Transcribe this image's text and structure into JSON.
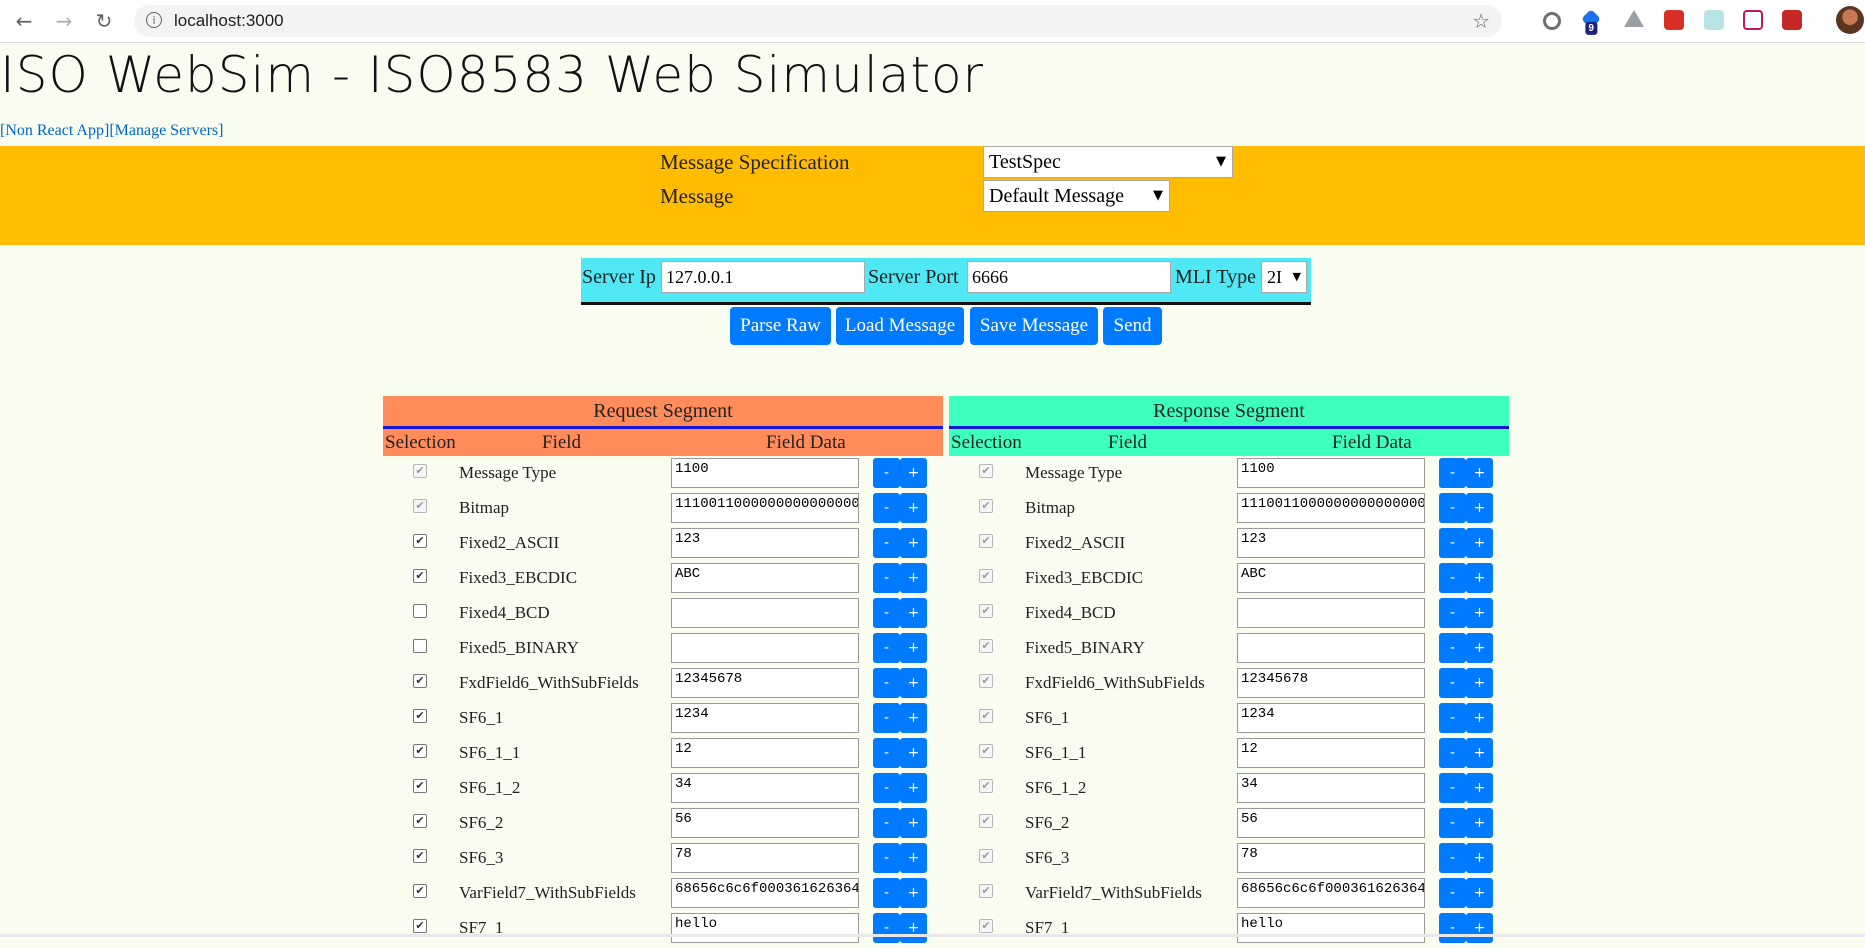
{
  "browser": {
    "url": "localhost:3000",
    "ext_badge": "9"
  },
  "page": {
    "title": "ISO WebSim - ISO8583 Web Simulator",
    "link_non_react": "[Non React App]",
    "link_manage_servers": "[Manage Servers]"
  },
  "spec": {
    "spec_label": "Message Specification",
    "spec_value": "TestSpec",
    "message_label": "Message",
    "message_value": "Default Message"
  },
  "server": {
    "ip_label": "Server Ip",
    "ip_value": "127.0.0.1",
    "port_label": "Server Port",
    "port_value": "6666",
    "mli_label": "MLI Type",
    "mli_value": "2I"
  },
  "actions": {
    "parse_raw": "Parse Raw",
    "load_message": "Load Message",
    "save_message": "Save Message",
    "send": "Send"
  },
  "request": {
    "title": "Request Segment",
    "color": "#ff8c5a",
    "col_selection": "Selection",
    "col_field": "Field",
    "col_data": "Field Data",
    "rows": [
      {
        "checked": true,
        "disabled": true,
        "field": "Message Type",
        "data": "1100"
      },
      {
        "checked": true,
        "disabled": true,
        "field": "Bitmap",
        "data": "1110011000000000000000"
      },
      {
        "checked": true,
        "disabled": false,
        "field": "Fixed2_ASCII",
        "data": "123"
      },
      {
        "checked": true,
        "disabled": false,
        "field": "Fixed3_EBCDIC",
        "data": "ABC"
      },
      {
        "checked": false,
        "disabled": false,
        "field": "Fixed4_BCD",
        "data": ""
      },
      {
        "checked": false,
        "disabled": false,
        "field": "Fixed5_BINARY",
        "data": ""
      },
      {
        "checked": true,
        "disabled": false,
        "field": "FxdField6_WithSubFields",
        "data": "12345678"
      },
      {
        "checked": true,
        "disabled": false,
        "field": "SF6_1",
        "data": "1234"
      },
      {
        "checked": true,
        "disabled": false,
        "field": "SF6_1_1",
        "data": "12"
      },
      {
        "checked": true,
        "disabled": false,
        "field": "SF6_1_2",
        "data": "34"
      },
      {
        "checked": true,
        "disabled": false,
        "field": "SF6_2",
        "data": "56"
      },
      {
        "checked": true,
        "disabled": false,
        "field": "SF6_3",
        "data": "78"
      },
      {
        "checked": true,
        "disabled": false,
        "field": "VarField7_WithSubFields",
        "data": "68656c6c6f000361626364"
      },
      {
        "checked": true,
        "disabled": false,
        "field": "SF7_1",
        "data": "hello"
      }
    ]
  },
  "response": {
    "title": "Response Segment",
    "color": "#3dffbe",
    "col_selection": "Selection",
    "col_field": "Field",
    "col_data": "Field Data",
    "rows": [
      {
        "checked": true,
        "disabled": true,
        "field": "Message Type",
        "data": "1100"
      },
      {
        "checked": true,
        "disabled": true,
        "field": "Bitmap",
        "data": "1110011000000000000000"
      },
      {
        "checked": true,
        "disabled": true,
        "field": "Fixed2_ASCII",
        "data": "123"
      },
      {
        "checked": true,
        "disabled": true,
        "field": "Fixed3_EBCDIC",
        "data": "ABC"
      },
      {
        "checked": true,
        "disabled": true,
        "field": "Fixed4_BCD",
        "data": ""
      },
      {
        "checked": true,
        "disabled": true,
        "field": "Fixed5_BINARY",
        "data": ""
      },
      {
        "checked": true,
        "disabled": true,
        "field": "FxdField6_WithSubFields",
        "data": "12345678"
      },
      {
        "checked": true,
        "disabled": true,
        "field": "SF6_1",
        "data": "1234"
      },
      {
        "checked": true,
        "disabled": true,
        "field": "SF6_1_1",
        "data": "12"
      },
      {
        "checked": true,
        "disabled": true,
        "field": "SF6_1_2",
        "data": "34"
      },
      {
        "checked": true,
        "disabled": true,
        "field": "SF6_2",
        "data": "56"
      },
      {
        "checked": true,
        "disabled": true,
        "field": "SF6_3",
        "data": "78"
      },
      {
        "checked": true,
        "disabled": true,
        "field": "VarField7_WithSubFields",
        "data": "68656c6c6f000361626364"
      },
      {
        "checked": true,
        "disabled": true,
        "field": "SF7_1",
        "data": "hello"
      }
    ]
  },
  "pm_minus": "-",
  "pm_plus": "+"
}
